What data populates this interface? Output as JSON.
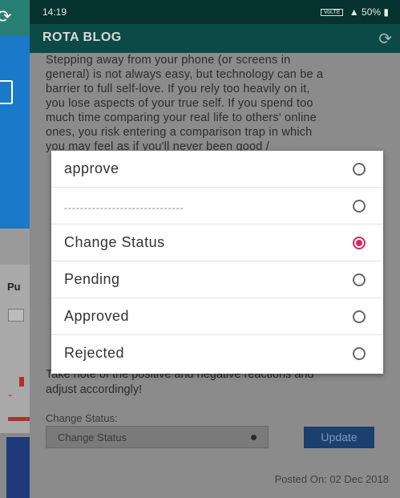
{
  "background_app": {
    "label_pu": "Pu"
  },
  "status_bar": {
    "time": "14:19",
    "network": "VoLTE",
    "battery": "50%"
  },
  "app_bar": {
    "title": "ROTA BLOG"
  },
  "post": {
    "body_lines": [
      "Stepping away from your phone (or screens in",
      "general) is not always easy, but technology can be a",
      "barrier to full self-love. If you rely too heavily on it,",
      "you lose aspects of your true self. If you spend too",
      "much time comparing your real life to others' online",
      "ones, you risk entering a comparison trap in which",
      "you may feel as if you'll never been good /"
    ],
    "body_end_lines": [
      "Take note of the positive and negative reactions and",
      "adjust accordingly!"
    ],
    "change_status_label": "Change Status:",
    "change_status_value": "Change Status",
    "update_button": "Update",
    "posted_on": "Posted On: 02 Dec 2018"
  },
  "dialog": {
    "options": [
      {
        "label": "approve",
        "checked": false
      },
      {
        "label": "------------------------------",
        "checked": false
      },
      {
        "label": "Change Status",
        "checked": true
      },
      {
        "label": "Pending",
        "checked": false
      },
      {
        "label": "Approved",
        "checked": false
      },
      {
        "label": "Rejected",
        "checked": false
      }
    ]
  },
  "colors": {
    "status_bar": "#06332f",
    "app_bar": "#0c4a45",
    "radio_checked": "#e0245e",
    "update_button": "#1b3f6e"
  }
}
